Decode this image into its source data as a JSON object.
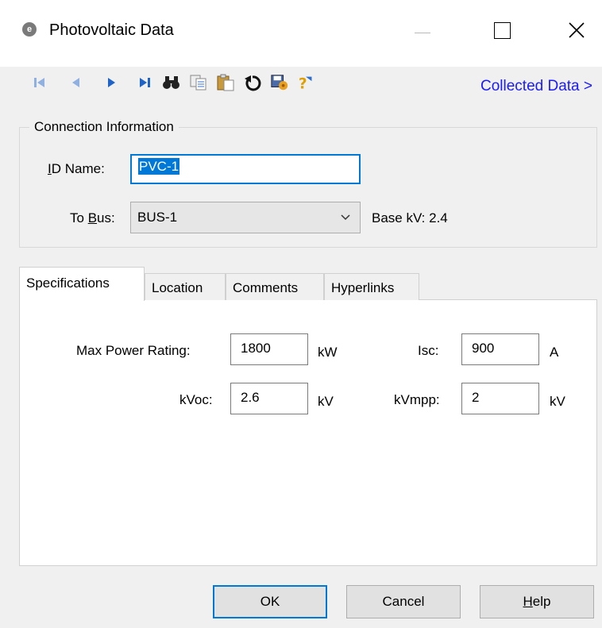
{
  "window": {
    "title": "Photovoltaic Data",
    "icon": "app-e-icon",
    "controls": [
      "minimize-icon",
      "maximize-icon",
      "close-icon"
    ]
  },
  "toolbar": {
    "icons": [
      "first-record-icon",
      "previous-record-icon",
      "next-record-icon",
      "last-record-icon",
      "find-icon",
      "copy-icon",
      "paste-icon",
      "undo-icon",
      "save-defaults-icon",
      "help-pointer-icon"
    ],
    "collected_link": "Collected Data >",
    "link_color": "#1a1aff"
  },
  "connection": {
    "legend": "Connection Information",
    "id_label_prefix": "I",
    "id_label_rest": "D Name:",
    "id_value": "PVC-1",
    "bus_label_prefix": "To ",
    "bus_label_ul": "B",
    "bus_label_rest": "us:",
    "bus_value": "BUS-1",
    "base_kv": "Base kV: 2.4"
  },
  "tabs": [
    "Specifications",
    "Location",
    "Comments",
    "Hyperlinks"
  ],
  "specs": {
    "max_power_label": "Max Power Rating:",
    "max_power_value": "1800",
    "max_power_unit": "kW",
    "isc_label": "Isc:",
    "isc_value": "900",
    "isc_unit": "A",
    "kvoc_label": "kVoc:",
    "kvoc_value": "2.6",
    "kvoc_unit": "kV",
    "kvmpp_label": "kVmpp:",
    "kvmpp_value": "2",
    "kvmpp_unit": "kV"
  },
  "buttons": {
    "ok": "OK",
    "cancel": "Cancel",
    "help_ul": "H",
    "help_rest": "elp"
  },
  "colors": {
    "accent": "#0078d7",
    "nav_blue": "#1e64c8"
  }
}
